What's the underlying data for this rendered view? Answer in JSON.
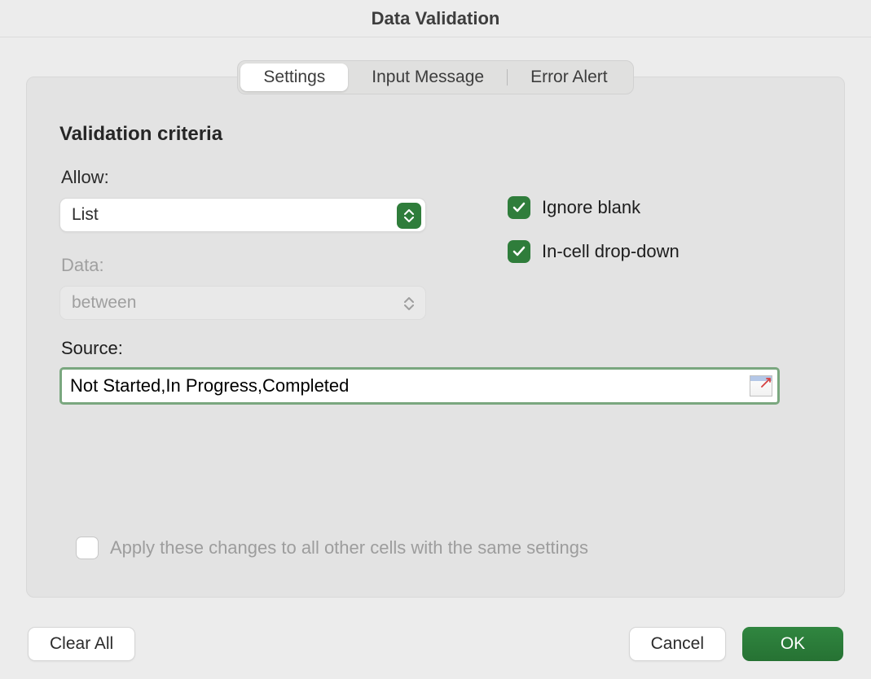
{
  "dialog": {
    "title": "Data Validation"
  },
  "tabs": {
    "settings": "Settings",
    "input_message": "Input Message",
    "error_alert": "Error Alert",
    "selected": "settings"
  },
  "criteria": {
    "section_title": "Validation criteria",
    "allow_label": "Allow:",
    "allow_value": "List",
    "data_label": "Data:",
    "data_value": "between",
    "source_label": "Source:",
    "source_value": "Not Started,In Progress,Completed",
    "ignore_blank_label": "Ignore blank",
    "ignore_blank_checked": true,
    "incell_label": "In-cell drop-down",
    "incell_checked": true,
    "apply_label": "Apply these changes to all other cells with the same settings",
    "apply_checked": false
  },
  "buttons": {
    "clear_all": "Clear All",
    "cancel": "Cancel",
    "ok": "OK"
  }
}
